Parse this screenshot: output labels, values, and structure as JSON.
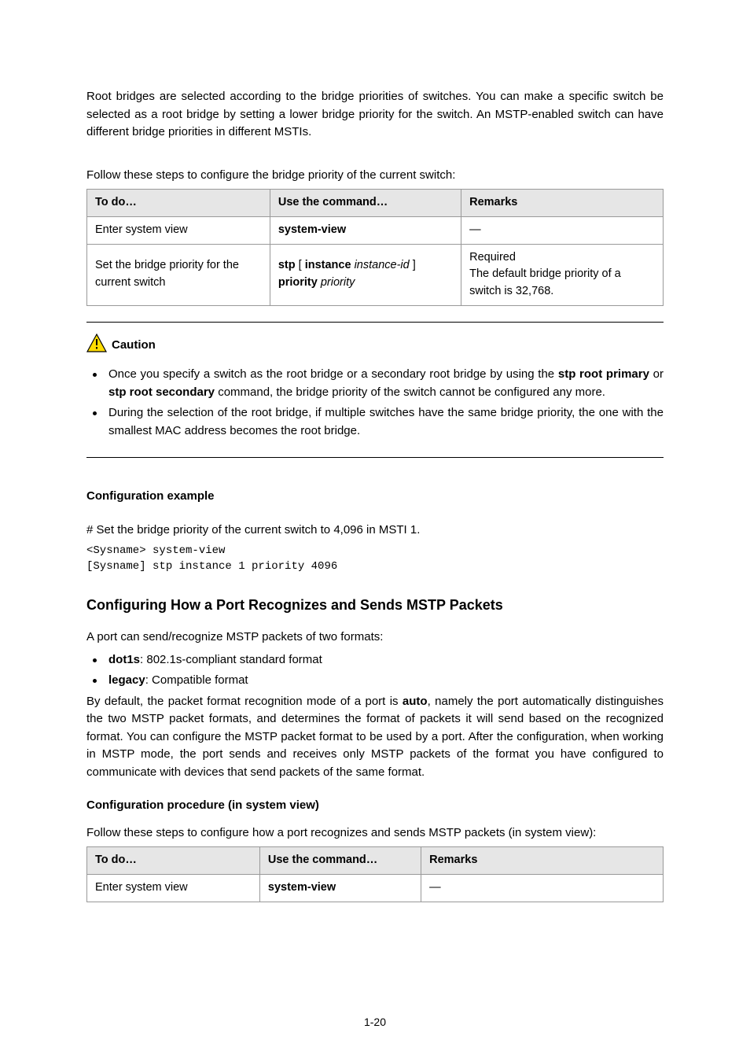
{
  "intro": "Root bridges are selected according to the bridge priorities of switches. You can make a specific switch be selected as a root bridge by setting a lower bridge priority for the switch. An MSTP-enabled switch can have different bridge priorities in different MSTIs.",
  "table1_caption": "Follow these steps to configure the bridge priority of the current switch:",
  "table1": {
    "headers": [
      "To do…",
      "Use the command…",
      "Remarks"
    ],
    "rows": [
      {
        "c1": "Enter system view",
        "c2": "system-view",
        "c3": "—"
      },
      {
        "c1": "Set the bridge priority for the current switch",
        "c2_pre": "stp ",
        "c2_open": "[ ",
        "c2_mid1": "instance ",
        "c2_mid2_italic": "instance-id",
        "c2_close": " ] ",
        "c2_kw": "priority ",
        "c2_val_italic": "priority",
        "c3a": "Required",
        "c3b": "The default bridge priority of a switch is 32,768."
      }
    ]
  },
  "caution_label": "Caution",
  "caution_items": [
    {
      "pre": "Once you specify a switch as the root bridge or a secondary root bridge by using the ",
      "b1": "stp root primary",
      "mid1": " or ",
      "b2": "stp root secondary",
      "post": " command, the bridge priority of the switch cannot be configured any more."
    },
    {
      "text": "During the selection of the root bridge, if multiple switches have the same bridge priority, the one with the smallest MAC address becomes the root bridge."
    }
  ],
  "example_heading": "Configuration example",
  "example_text": "# Set the bridge priority of the current switch to 4,096 in MSTI 1.",
  "example_code": "<Sysname> system-view\n[Sysname] stp instance 1 priority 4096",
  "section_heading": "Configuring How a Port Recognizes and Sends MSTP Packets",
  "formats_intro": "A port can send/recognize MSTP packets of two formats:",
  "format_items": [
    {
      "b": "dot1s",
      "t": ": 802.1s-compliant standard format"
    },
    {
      "b": "legacy",
      "t": ": Compatible format"
    }
  ],
  "formats_para_pre": "By default, the packet format recognition mode of a port is ",
  "formats_para_b": "auto",
  "formats_para_post": ", namely the port automatically distinguishes the two MSTP packet formats, and determines the format of packets it will send based on the recognized format. You can configure the MSTP packet format to be used by a port. After the configuration, when working in MSTP mode, the port sends and receives only MSTP packets of the format you have configured to communicate with devices that send packets of the same format.",
  "sysview_heading": "Configuration procedure (in system view)",
  "table2_caption": "Follow these steps to configure how a port recognizes and sends MSTP packets (in system view):",
  "table2": {
    "headers": [
      "To do…",
      "Use the command…",
      "Remarks"
    ],
    "rows": [
      {
        "c1": "Enter system view",
        "c2": "system-view",
        "c3": "—"
      }
    ]
  },
  "page_number": "1-20"
}
